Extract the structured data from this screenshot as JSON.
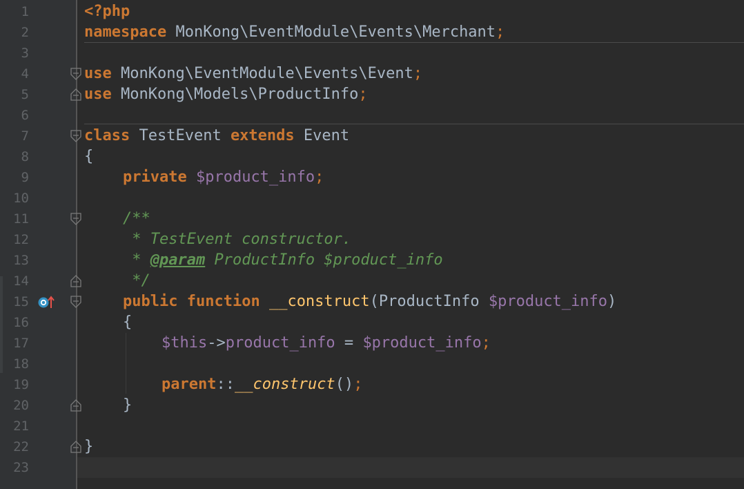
{
  "editor": {
    "line_numbers": [
      "1",
      "2",
      "3",
      "4",
      "5",
      "6",
      "7",
      "8",
      "9",
      "10",
      "11",
      "12",
      "13",
      "14",
      "15",
      "16",
      "17",
      "18",
      "19",
      "20",
      "21",
      "22",
      "23"
    ],
    "code": {
      "l1": {
        "open_tag": "<?php"
      },
      "l2": {
        "kw": "namespace",
        "name": " MonKong\\EventModule\\Events\\Merchant",
        "semi": ";"
      },
      "l4": {
        "kw": "use",
        "name": " MonKong\\EventModule\\Events\\Event",
        "semi": ";"
      },
      "l5": {
        "kw": "use",
        "name": " MonKong\\Models\\ProductInfo",
        "semi": ";"
      },
      "l7": {
        "kw1": "class",
        "name": " TestEvent ",
        "kw2": "extends",
        "parent": " Event"
      },
      "l8": {
        "text": "{"
      },
      "l9": {
        "kw": "private",
        "sp": " ",
        "var": "$product_info",
        "semi": ";"
      },
      "l11": {
        "text": "/**"
      },
      "l12": {
        "text": " * TestEvent constructor."
      },
      "l13": {
        "pre": " * ",
        "tag": "@param",
        "post": " ProductInfo $product_info"
      },
      "l14": {
        "text": " */"
      },
      "l15": {
        "kw1": "public",
        "sp1": " ",
        "kw2": "function",
        "sp2": " ",
        "fn": "__construct",
        "open": "(ProductInfo ",
        "var": "$product_info",
        "close": ")"
      },
      "l16": {
        "text": "{"
      },
      "l17": {
        "this": "$this",
        "arrow": "->",
        "prop": "product_info",
        "eq": " = ",
        "var": "$product_info",
        "semi": ";"
      },
      "l19": {
        "kw": "parent",
        "dc": "::",
        "call": "__construct",
        "parens": "()",
        "semi": ";"
      },
      "l20": {
        "text": "}"
      },
      "l22": {
        "text": "}"
      }
    },
    "colors": {
      "background": "#2b2b2b",
      "gutter": "#313335",
      "keyword": "#cc7832",
      "identifier": "#a9b7c6",
      "variable": "#9876aa",
      "function": "#ffc66d",
      "doc_comment": "#629755",
      "line_number": "#606366",
      "current_line": "#323232"
    },
    "icons": {
      "override": "override-method-icon",
      "fold": "fold-marker-icon"
    }
  }
}
